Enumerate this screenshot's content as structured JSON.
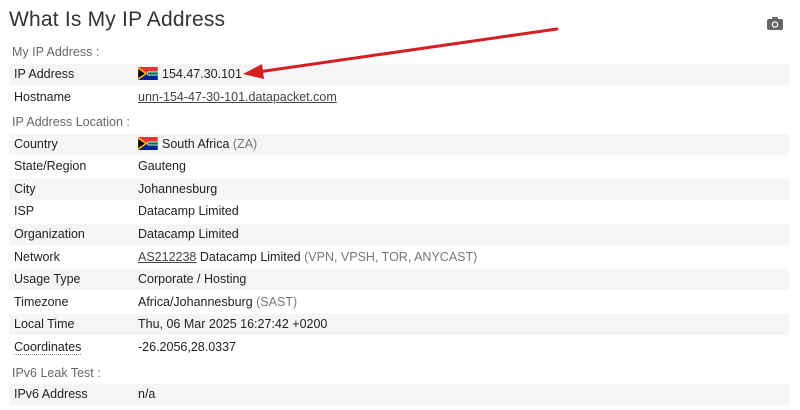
{
  "title": "What Is My IP Address",
  "icons": {
    "camera": "camera-icon",
    "flag": "south-africa-flag-icon"
  },
  "accent_color": "#d42020",
  "sections": {
    "my_ip": "My IP Address :",
    "location": "IP Address Location :",
    "ipv6": "IPv6 Leak Test :"
  },
  "my_ip": {
    "ip_label": "IP Address",
    "ip_value": "154.47.30.101",
    "hostname_label": "Hostname",
    "hostname_value": "unn-154-47-30-101.datapacket.com"
  },
  "location": {
    "country_label": "Country",
    "country_value": "South Africa",
    "country_code": "(ZA)",
    "state_label": "State/Region",
    "state_value": "Gauteng",
    "city_label": "City",
    "city_value": "Johannesburg",
    "isp_label": "ISP",
    "isp_value": "Datacamp Limited",
    "org_label": "Organization",
    "org_value": "Datacamp Limited",
    "network_label": "Network",
    "network_asn": "AS212238",
    "network_name": "Datacamp Limited",
    "network_note": "(VPN, VPSH, TOR, ANYCAST)",
    "usage_label": "Usage Type",
    "usage_value": "Corporate / Hosting",
    "tz_label": "Timezone",
    "tz_value": "Africa/Johannesburg",
    "tz_abbr": "(SAST)",
    "localtime_label": "Local Time",
    "localtime_value": "Thu, 06 Mar 2025 16:27:42 +0200",
    "coords_label": "Coordinates",
    "coords_value": "-26.2056,28.0337"
  },
  "ipv6": {
    "label": "IPv6 Address",
    "value": "n/a"
  }
}
